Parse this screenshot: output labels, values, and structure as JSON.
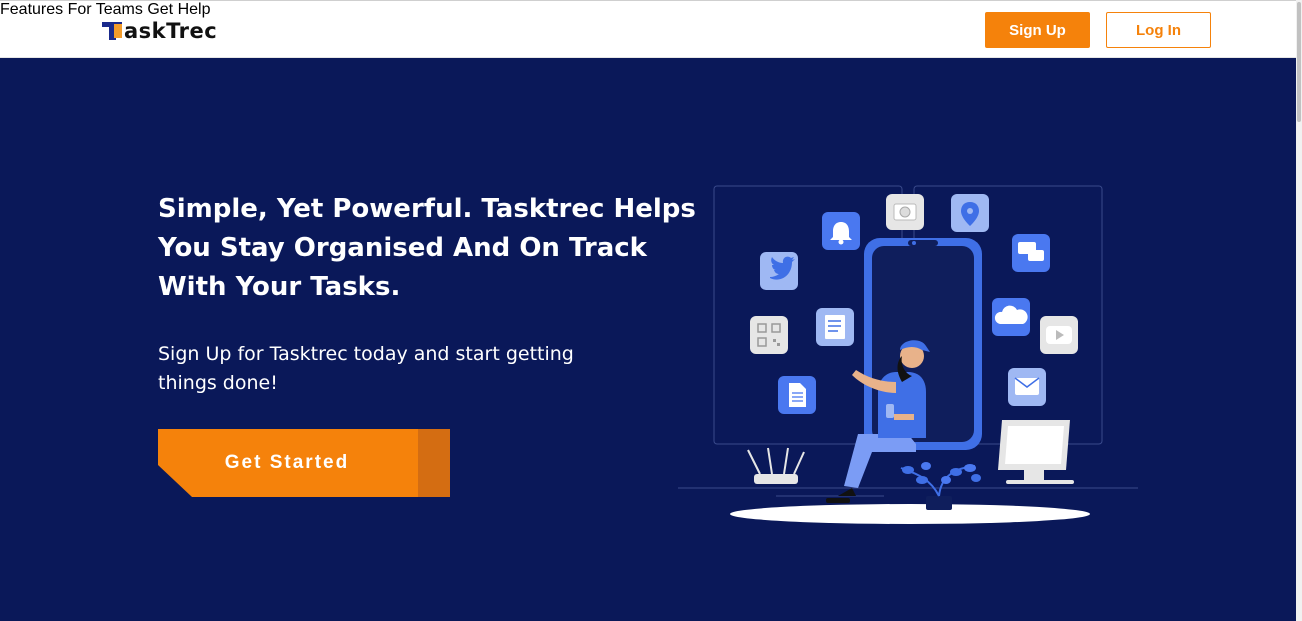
{
  "brand": {
    "logo_text": "askTrec",
    "logo_mark_icon": "logo-t-mark",
    "accent_color": "#f5820b",
    "primary_bg": "#0a1859"
  },
  "nav": {
    "items": [
      {
        "label": "Features"
      },
      {
        "label": "For Teams"
      },
      {
        "label": "Get Help"
      }
    ],
    "signup_label": "Sign Up",
    "login_label": "Log In"
  },
  "hero": {
    "title": "Simple, Yet Powerful. Tasktrec Helps You Stay Organised And On Track With Your Tasks.",
    "subtitle": "Sign Up for Tasktrec today and start getting things done!",
    "cta_label": "Get Started"
  },
  "illustration": {
    "icons": [
      "bell-icon",
      "camera-icon",
      "location-pin-icon",
      "twitter-icon",
      "chat-icon",
      "cloud-icon",
      "qr-code-icon",
      "document-icon",
      "youtube-icon",
      "file-icon",
      "mail-icon",
      "router-icon",
      "monitor-icon",
      "plant-icon",
      "phone-icon",
      "person-icon"
    ]
  }
}
